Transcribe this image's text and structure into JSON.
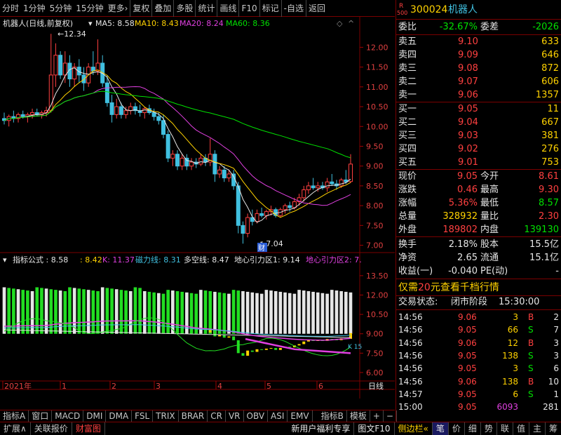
{
  "toolbar": {
    "items": [
      "分时",
      "1分钟",
      "5分钟",
      "15分钟",
      "更多›",
      "复权",
      "叠加",
      "多股",
      "统计",
      "画线",
      "F10",
      "标记",
      "-自选",
      "返回"
    ]
  },
  "chart": {
    "stock_title": "机器人(日线,前复权)",
    "ma": [
      {
        "label": "MA5: 8.58",
        "color": "#e6e6e6"
      },
      {
        "label": "MA10: 8.43",
        "color": "#ffd200"
      },
      {
        "label": "MA20: 8.24",
        "color": "#e040e0"
      },
      {
        "label": "MA60: 8.36",
        "color": "#00e000"
      }
    ],
    "high_label": "12.34",
    "low_label": "7.04",
    "fin_tag": "财",
    "y_ticks_price": [
      "12.00",
      "11.50",
      "11.00",
      "10.50",
      "10.00",
      "9.50",
      "9.00",
      "8.50",
      "8.00",
      "7.50",
      "7.00"
    ],
    "ind_header": [
      {
        "t": "指标公式 : 8.58",
        "c": "#e6e6e6"
      },
      {
        "t": ": 8.42",
        "c": "#ffd200"
      },
      {
        "t": "K: 11.37",
        "c": "#e040e0"
      },
      {
        "t": "磁力线: 8.31",
        "c": "#40c0e0"
      },
      {
        "t": "多空线: 8.47",
        "c": "#e6e6e6"
      },
      {
        "t": "地心引力区1: 9.14",
        "c": "#e6e6e6"
      },
      {
        "t": "地心引力区2: 7.",
        "c": "#e040e0"
      }
    ],
    "y_ticks_ind": [
      "13.50",
      "12.00",
      "10.50",
      "9.00",
      "7.50",
      "6.00"
    ],
    "ind_tag": "K 15",
    "x_labels": [
      "2021年",
      "1",
      "2",
      "3",
      "4",
      "5",
      "6"
    ],
    "x_tab": "日线"
  },
  "chart_data": {
    "type": "candlestick",
    "y_range": [
      6.85,
      12.45
    ],
    "candles": [
      {
        "o": 10.2,
        "h": 10.35,
        "l": 10.05,
        "c": 10.15
      },
      {
        "o": 10.15,
        "h": 10.3,
        "l": 10.0,
        "c": 10.25
      },
      {
        "o": 10.25,
        "h": 10.4,
        "l": 10.1,
        "c": 10.2
      },
      {
        "o": 10.2,
        "h": 10.35,
        "l": 10.1,
        "c": 10.3
      },
      {
        "o": 10.3,
        "h": 10.4,
        "l": 10.2,
        "c": 10.25
      },
      {
        "o": 10.25,
        "h": 10.35,
        "l": 10.1,
        "c": 10.3
      },
      {
        "o": 10.3,
        "h": 10.45,
        "l": 10.2,
        "c": 10.35
      },
      {
        "o": 10.35,
        "h": 10.45,
        "l": 10.25,
        "c": 10.3
      },
      {
        "o": 10.3,
        "h": 10.4,
        "l": 10.2,
        "c": 10.35
      },
      {
        "o": 10.35,
        "h": 10.5,
        "l": 10.25,
        "c": 10.4
      },
      {
        "o": 10.4,
        "h": 12.34,
        "l": 10.35,
        "c": 11.3
      },
      {
        "o": 11.3,
        "h": 12.1,
        "l": 11.0,
        "c": 11.8
      },
      {
        "o": 11.8,
        "h": 11.9,
        "l": 11.2,
        "c": 11.3
      },
      {
        "o": 11.3,
        "h": 11.9,
        "l": 11.1,
        "c": 11.6
      },
      {
        "o": 11.6,
        "h": 11.8,
        "l": 11.0,
        "c": 11.2
      },
      {
        "o": 11.2,
        "h": 11.6,
        "l": 11.0,
        "c": 11.5
      },
      {
        "o": 11.5,
        "h": 11.7,
        "l": 11.1,
        "c": 11.3
      },
      {
        "o": 11.3,
        "h": 11.5,
        "l": 10.9,
        "c": 11.1
      },
      {
        "o": 11.1,
        "h": 11.6,
        "l": 11.0,
        "c": 11.5
      },
      {
        "o": 11.5,
        "h": 11.9,
        "l": 11.3,
        "c": 11.4
      },
      {
        "o": 11.4,
        "h": 12.2,
        "l": 11.3,
        "c": 11.6
      },
      {
        "o": 11.6,
        "h": 11.8,
        "l": 11.0,
        "c": 11.1
      },
      {
        "o": 11.1,
        "h": 11.3,
        "l": 10.5,
        "c": 10.6
      },
      {
        "o": 10.6,
        "h": 10.8,
        "l": 10.1,
        "c": 10.3
      },
      {
        "o": 10.3,
        "h": 10.7,
        "l": 10.2,
        "c": 10.5
      },
      {
        "o": 10.5,
        "h": 10.6,
        "l": 10.2,
        "c": 10.3
      },
      {
        "o": 10.3,
        "h": 10.5,
        "l": 10.2,
        "c": 10.4
      },
      {
        "o": 10.4,
        "h": 10.6,
        "l": 10.3,
        "c": 10.5
      },
      {
        "o": 10.5,
        "h": 10.6,
        "l": 10.3,
        "c": 10.4
      },
      {
        "o": 10.4,
        "h": 10.55,
        "l": 10.25,
        "c": 10.35
      },
      {
        "o": 10.35,
        "h": 10.5,
        "l": 10.2,
        "c": 10.45
      },
      {
        "o": 10.45,
        "h": 10.55,
        "l": 10.3,
        "c": 10.35
      },
      {
        "o": 10.35,
        "h": 10.45,
        "l": 10.15,
        "c": 10.25
      },
      {
        "o": 10.25,
        "h": 10.35,
        "l": 10.05,
        "c": 10.15
      },
      {
        "o": 10.15,
        "h": 10.3,
        "l": 9.7,
        "c": 9.8
      },
      {
        "o": 9.8,
        "h": 9.9,
        "l": 9.1,
        "c": 9.2
      },
      {
        "o": 9.2,
        "h": 9.4,
        "l": 9.0,
        "c": 9.3
      },
      {
        "o": 9.3,
        "h": 9.4,
        "l": 8.9,
        "c": 9.0
      },
      {
        "o": 9.0,
        "h": 9.3,
        "l": 8.9,
        "c": 9.2
      },
      {
        "o": 9.2,
        "h": 9.3,
        "l": 8.9,
        "c": 9.0
      },
      {
        "o": 9.0,
        "h": 9.2,
        "l": 8.9,
        "c": 9.1
      },
      {
        "o": 9.1,
        "h": 9.2,
        "l": 8.95,
        "c": 9.05
      },
      {
        "o": 9.05,
        "h": 9.3,
        "l": 9.0,
        "c": 9.2
      },
      {
        "o": 9.2,
        "h": 9.3,
        "l": 9.0,
        "c": 9.1
      },
      {
        "o": 9.1,
        "h": 9.7,
        "l": 9.0,
        "c": 9.3
      },
      {
        "o": 9.3,
        "h": 9.4,
        "l": 8.6,
        "c": 8.8
      },
      {
        "o": 8.8,
        "h": 9.0,
        "l": 8.7,
        "c": 8.9
      },
      {
        "o": 8.9,
        "h": 9.0,
        "l": 8.6,
        "c": 8.7
      },
      {
        "o": 8.7,
        "h": 8.9,
        "l": 8.6,
        "c": 8.8
      },
      {
        "o": 8.8,
        "h": 8.9,
        "l": 8.4,
        "c": 8.5
      },
      {
        "o": 8.5,
        "h": 8.6,
        "l": 7.3,
        "c": 7.5
      },
      {
        "o": 7.5,
        "h": 7.6,
        "l": 7.04,
        "c": 7.3
      },
      {
        "o": 7.3,
        "h": 7.8,
        "l": 7.2,
        "c": 7.7
      },
      {
        "o": 7.7,
        "h": 7.9,
        "l": 7.5,
        "c": 7.6
      },
      {
        "o": 7.6,
        "h": 7.9,
        "l": 7.55,
        "c": 7.8
      },
      {
        "o": 7.8,
        "h": 7.95,
        "l": 7.7,
        "c": 7.75
      },
      {
        "o": 7.75,
        "h": 7.9,
        "l": 7.65,
        "c": 7.85
      },
      {
        "o": 7.85,
        "h": 8.0,
        "l": 7.75,
        "c": 7.9
      },
      {
        "o": 7.9,
        "h": 7.95,
        "l": 7.7,
        "c": 7.75
      },
      {
        "o": 7.75,
        "h": 7.95,
        "l": 7.7,
        "c": 7.9
      },
      {
        "o": 7.9,
        "h": 8.05,
        "l": 7.8,
        "c": 8.0
      },
      {
        "o": 8.0,
        "h": 8.1,
        "l": 7.85,
        "c": 7.95
      },
      {
        "o": 7.95,
        "h": 8.2,
        "l": 7.9,
        "c": 8.1
      },
      {
        "o": 8.1,
        "h": 8.3,
        "l": 8.0,
        "c": 8.2
      },
      {
        "o": 8.2,
        "h": 8.5,
        "l": 8.1,
        "c": 8.4
      },
      {
        "o": 8.4,
        "h": 8.6,
        "l": 8.3,
        "c": 8.5
      },
      {
        "o": 8.5,
        "h": 8.7,
        "l": 8.4,
        "c": 8.45
      },
      {
        "o": 8.45,
        "h": 8.6,
        "l": 8.35,
        "c": 8.5
      },
      {
        "o": 8.5,
        "h": 8.6,
        "l": 8.4,
        "c": 8.45
      },
      {
        "o": 8.45,
        "h": 8.7,
        "l": 8.35,
        "c": 8.6
      },
      {
        "o": 8.6,
        "h": 8.8,
        "l": 8.5,
        "c": 8.55
      },
      {
        "o": 8.55,
        "h": 8.65,
        "l": 8.4,
        "c": 8.5
      },
      {
        "o": 8.5,
        "h": 8.7,
        "l": 8.45,
        "c": 8.65
      },
      {
        "o": 8.65,
        "h": 8.9,
        "l": 8.55,
        "c": 8.6
      },
      {
        "o": 8.61,
        "h": 9.3,
        "l": 8.57,
        "c": 9.05
      }
    ]
  },
  "quote": {
    "code": "300024",
    "name": "机器人",
    "r_badge": "R",
    "idx_badge": "500",
    "webi_label": "委比",
    "webi": "-32.67%",
    "wecha_label": "委差",
    "wecha": "-2026",
    "asks": [
      {
        "l": "卖五",
        "p": "9.10",
        "v": "633"
      },
      {
        "l": "卖四",
        "p": "9.09",
        "v": "646"
      },
      {
        "l": "卖三",
        "p": "9.08",
        "v": "872"
      },
      {
        "l": "卖二",
        "p": "9.07",
        "v": "606"
      },
      {
        "l": "卖一",
        "p": "9.06",
        "v": "1357"
      }
    ],
    "bids": [
      {
        "l": "买一",
        "p": "9.05",
        "v": "11"
      },
      {
        "l": "买二",
        "p": "9.04",
        "v": "667"
      },
      {
        "l": "买三",
        "p": "9.03",
        "v": "381"
      },
      {
        "l": "买四",
        "p": "9.02",
        "v": "276"
      },
      {
        "l": "买五",
        "p": "9.01",
        "v": "753"
      }
    ],
    "stats": [
      {
        "l1": "现价",
        "v1": "9.05",
        "c1": "red",
        "l2": "今开",
        "v2": "8.61",
        "c2": "red"
      },
      {
        "l1": "涨跌",
        "v1": "0.46",
        "c1": "red",
        "l2": "最高",
        "v2": "9.30",
        "c2": "red"
      },
      {
        "l1": "涨幅",
        "v1": "5.36%",
        "c1": "red",
        "l2": "最低",
        "v2": "8.57",
        "c2": "green"
      },
      {
        "l1": "总量",
        "v1": "328932",
        "c1": "yellow",
        "l2": "量比",
        "v2": "2.30",
        "c2": "red"
      },
      {
        "l1": "外盘",
        "v1": "189802",
        "c1": "red",
        "l2": "内盘",
        "v2": "139130",
        "c2": "green"
      }
    ],
    "stats2": [
      {
        "l1": "换手",
        "v1": "2.18%",
        "l2": "股本",
        "v2": "15.5亿"
      },
      {
        "l1": "净资",
        "v1": "2.65",
        "l2": "流通",
        "v2": "15.1亿"
      },
      {
        "l1": "收益(一)",
        "v1": "-0.040",
        "l2": "PE(动)",
        "v2": "-"
      }
    ],
    "promo_pre": "仅需",
    "promo_num": "20",
    "promo_post": "元查看千档行情",
    "trade_label": "交易状态:",
    "trade_state": "闭市阶段",
    "trade_time": "15:30:00",
    "ticks": [
      {
        "t": "14:56",
        "p": "9.06",
        "v": "3",
        "s": "B",
        "n": "2"
      },
      {
        "t": "14:56",
        "p": "9.05",
        "v": "66",
        "s": "S",
        "n": "7"
      },
      {
        "t": "14:56",
        "p": "9.06",
        "v": "12",
        "s": "B",
        "n": "3"
      },
      {
        "t": "14:56",
        "p": "9.05",
        "v": "138",
        "s": "S",
        "n": "3"
      },
      {
        "t": "14:56",
        "p": "9.05",
        "v": "3",
        "s": "S",
        "n": "6"
      },
      {
        "t": "14:56",
        "p": "9.06",
        "v": "138",
        "s": "B",
        "n": "10"
      },
      {
        "t": "14:57",
        "p": "9.05",
        "v": "6",
        "s": "S",
        "n": "1"
      },
      {
        "t": "15:00",
        "p": "9.05",
        "v": "6093",
        "s": "",
        "n": "281"
      }
    ]
  },
  "bottom_tabs": [
    "指标A",
    "窗口",
    "MACD",
    "DMI",
    "DMA",
    "FSL",
    "TRIX",
    "BRAR",
    "CR",
    "VR",
    "OBV",
    "ASI",
    "EMV",
    "",
    "指标B",
    "模板",
    "+",
    "−"
  ],
  "status": {
    "left": [
      "扩展∧",
      "关联报价",
      "财富图"
    ],
    "mid": [
      "新用户福利专享",
      "图文F10",
      "侧边栏«"
    ],
    "right": [
      "笔",
      "价",
      "细",
      "势",
      "联",
      "值",
      "主",
      "筹"
    ]
  }
}
